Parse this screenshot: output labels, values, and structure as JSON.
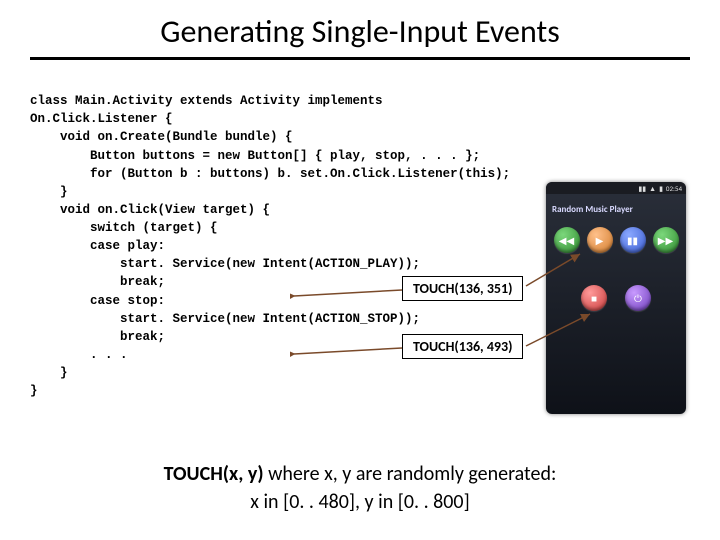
{
  "title": "Generating Single-Input Events",
  "code": {
    "l1": "class Main.Activity extends Activity implements",
    "l2": "On.Click.Listener {",
    "l3": "    void on.Create(Bundle bundle) {",
    "l4": "        Button buttons = new Button[] { play, stop, . . . };",
    "l5": "        for (Button b : buttons) b. set.On.Click.Listener(this);",
    "l6": "    }",
    "l7": "    void on.Click(View target) {",
    "l8": "        switch (target) {",
    "l9": "        case play:",
    "l10": "            start. Service(new Intent(ACTION_PLAY));",
    "l11": "            break;",
    "l12": "        case stop:",
    "l13": "            start. Service(new Intent(ACTION_STOP));",
    "l14": "            break;",
    "l15": "        . . .",
    "l16": "    }",
    "l17": "}"
  },
  "callouts": {
    "c1": "TOUCH(136, 351)",
    "c2": "TOUCH(136, 493)"
  },
  "phone": {
    "time": "02:54",
    "app_title": "Random Music Player",
    "icons": {
      "prev": "◀◀",
      "play": "▶",
      "pause": "▮▮",
      "next": "▶▶",
      "stop": "■",
      "power": "⏻"
    }
  },
  "footer": {
    "line1_bold": "TOUCH(x, y)",
    "line1_rest": " where x, y are randomly generated:",
    "line2": "x in [0. . 480], y in [0. . 800]"
  }
}
